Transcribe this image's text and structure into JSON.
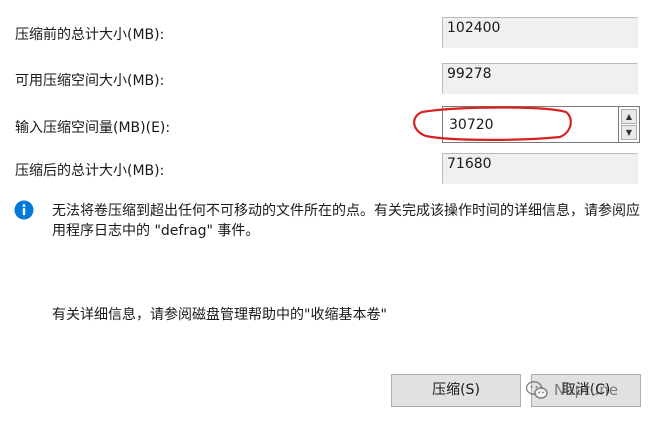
{
  "rows": [
    {
      "label": "压缩前的总计大小(MB):",
      "value": "102400"
    },
    {
      "label": "可用压缩空间大小(MB):",
      "value": "99278"
    },
    {
      "label": "输入压缩空间量(MB)(E):",
      "value": "30720"
    },
    {
      "label": "压缩后的总计大小(MB):",
      "value": "71680"
    }
  ],
  "info_message": "无法将卷压缩到超出任何不可移动的文件所在的点。有关完成该操作时间的详细信息，请参阅应用程序日志中的 \"defrag\" 事件。",
  "help_message": "有关详细信息，请参阅磁盘管理帮助中的\"收缩基本卷\"",
  "buttons": {
    "shrink": "压缩(S)",
    "cancel": "取消(C)"
  },
  "watermark": "Neptune",
  "colors": {
    "accent": "#0078d7",
    "highlight": "#d62222",
    "button_face": "#e1e1e1",
    "readonly_field": "#f0f0f0"
  },
  "icons": [
    "info-icon",
    "spin-up-icon",
    "spin-down-icon",
    "wechat-icon"
  ]
}
